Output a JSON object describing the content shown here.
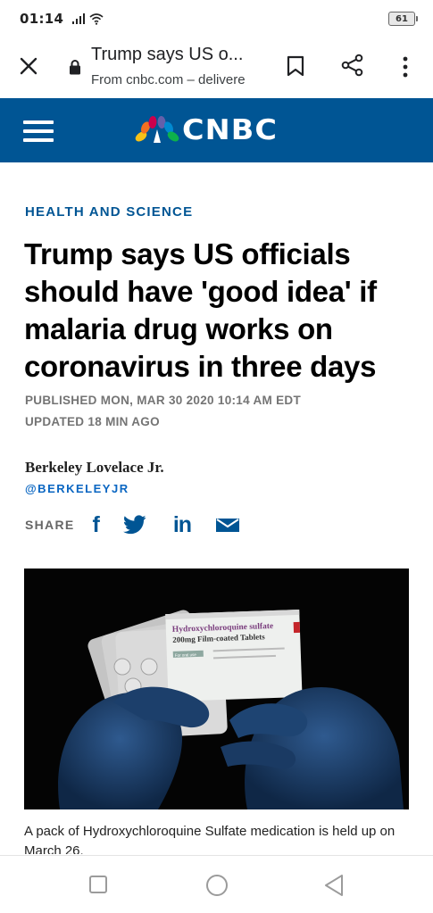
{
  "status_bar": {
    "time": "01:14",
    "battery": "61"
  },
  "browser": {
    "page_title": "Trump says US o...",
    "source": "From cnbc.com – delivere"
  },
  "site": {
    "logo_text": "CNBC",
    "brand_color": "#005594"
  },
  "article": {
    "section": "HEALTH AND SCIENCE",
    "headline": "Trump says US officials should have 'good idea' if malaria drug works on coronavirus in three days",
    "published": "PUBLISHED MON, MAR 30 2020 10:14 AM EDT",
    "updated": "UPDATED 18 MIN AGO",
    "author": "Berkeley Lovelace Jr.",
    "author_handle": "@BERKELEYJR",
    "share_label": "SHARE",
    "share_icons": [
      "facebook-icon",
      "twitter-icon",
      "linkedin-icon",
      "email-icon"
    ],
    "share_glyphs": {
      "facebook": "f",
      "linkedin": "in"
    },
    "photo": {
      "box_line1": "Hydroxychloroquine sulfate",
      "box_line2": "200mg Film-coated Tablets",
      "box_small": "For oral use"
    },
    "caption": "A pack of Hydroxychloroquine Sulfate medication is held up on March 26."
  },
  "nav": [
    "recent-apps-button",
    "home-button",
    "back-button"
  ]
}
